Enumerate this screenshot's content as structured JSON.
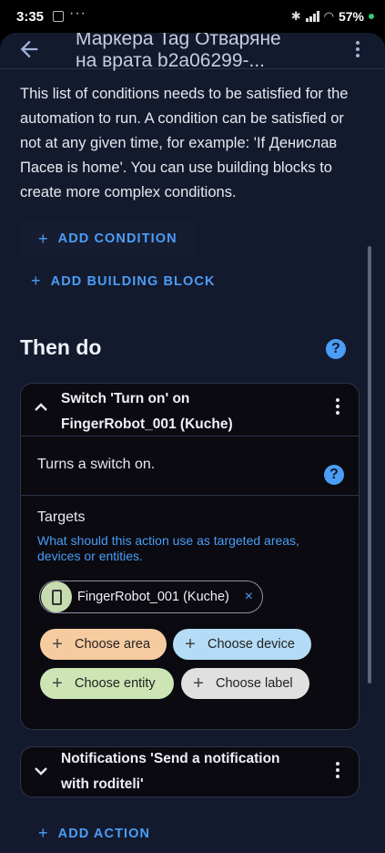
{
  "status_bar": {
    "time": "3:35",
    "extra": "···",
    "battery": "57%"
  },
  "app_bar": {
    "title_line1": "Маркера Tag Отваряне",
    "title_line2": "на врата b2a06299-..."
  },
  "conditions": {
    "intro": "This list of conditions needs to be satisfied for the automation to run. A condition can be satisfied or not at any given time, for example: 'If Денислав Пасев is home'. You can use building blocks to create more complex conditions.",
    "add_condition": "ADD CONDITION",
    "add_building_block": "ADD BUILDING BLOCK"
  },
  "actions": {
    "title": "Then do",
    "cards": [
      {
        "title_line1": "Switch 'Turn on' on",
        "title_line2": "FingerRobot_001 (Kuche)",
        "description": "Turns a switch on.",
        "targets_label": "Targets",
        "targets_hint": "What should this action use as targeted areas, devices or entities.",
        "entity_chip": "FingerRobot_001 (Kuche)",
        "pickers": {
          "area": "Choose area",
          "device": "Choose device",
          "entity": "Choose entity",
          "label": "Choose label"
        }
      },
      {
        "title_line1": "Notifications 'Send a notification",
        "title_line2": "with roditeli'"
      }
    ],
    "add_action": "ADD ACTION"
  },
  "colors": {
    "accent": "#4b9df6",
    "background": "#131a2e",
    "card": "#0a0a10"
  },
  "icons": [
    "back-arrow-icon",
    "more-vert-icon",
    "help-icon",
    "chevron-up-icon",
    "chevron-down-icon",
    "plus-icon",
    "close-icon",
    "phone-icon"
  ]
}
